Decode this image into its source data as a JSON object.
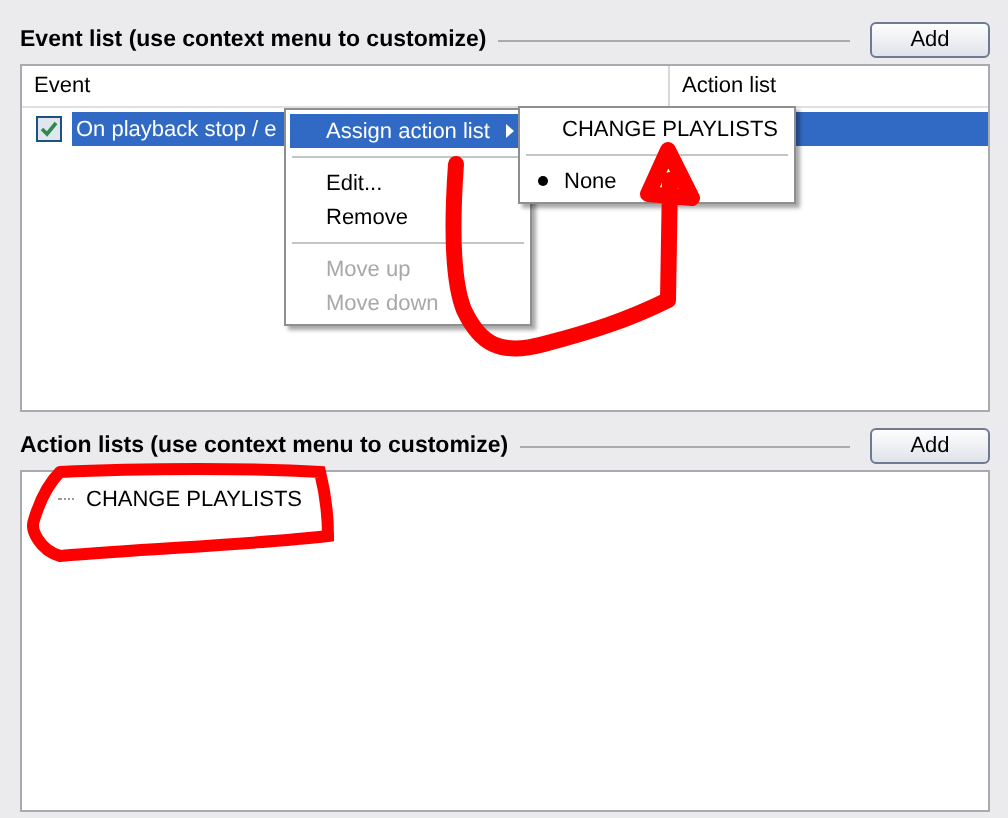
{
  "event_section": {
    "title": "Event list (use context menu to customize)",
    "add_button": "Add",
    "columns": [
      "Event",
      "Action list"
    ],
    "rows": [
      {
        "event": "On playback stop / e",
        "checked": true,
        "selected": true
      }
    ]
  },
  "context_menu": {
    "items": [
      {
        "kind": "submenu",
        "label": "Assign action list",
        "selected": true,
        "disabled": false
      },
      {
        "kind": "separator"
      },
      {
        "kind": "item",
        "label": "Edit...",
        "selected": false,
        "disabled": false
      },
      {
        "kind": "item",
        "label": "Remove",
        "selected": false,
        "disabled": false
      },
      {
        "kind": "separator"
      },
      {
        "kind": "item",
        "label": "Move up",
        "selected": false,
        "disabled": true
      },
      {
        "kind": "item",
        "label": "Move down",
        "selected": false,
        "disabled": true
      }
    ]
  },
  "submenu": {
    "items": [
      {
        "kind": "item",
        "label": "CHANGE PLAYLISTS",
        "selected": false,
        "checked": false
      },
      {
        "kind": "separator"
      },
      {
        "kind": "item",
        "label": "None",
        "selected": false,
        "checked": true
      }
    ]
  },
  "action_section": {
    "title": "Action lists (use context menu to customize)",
    "add_button": "Add",
    "items": [
      "CHANGE PLAYLISTS"
    ]
  }
}
